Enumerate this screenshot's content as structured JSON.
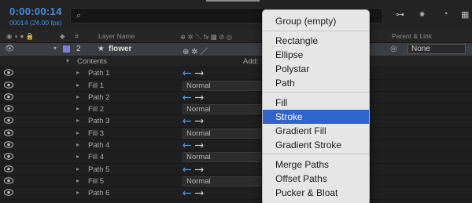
{
  "timecode": "0:00:00:14",
  "frames": "00014 (24.00 fps)",
  "search_icon": "⌕",
  "header": {
    "layer_name": "Layer Name",
    "add": "Add:",
    "parent": "Parent & Link",
    "hash": "#"
  },
  "layer": {
    "number": "2",
    "name": "flower",
    "parent_value": "None",
    "star_icon": "★"
  },
  "contents_label": "Contents",
  "rows": [
    {
      "name": "Path 1",
      "kind": "path"
    },
    {
      "name": "Fill 1",
      "kind": "fill",
      "mode": "Normal"
    },
    {
      "name": "Path 2",
      "kind": "path"
    },
    {
      "name": "Fill 2",
      "kind": "fill",
      "mode": "Normal"
    },
    {
      "name": "Path 3",
      "kind": "path"
    },
    {
      "name": "Fill 3",
      "kind": "fill",
      "mode": "Normal"
    },
    {
      "name": "Path 4",
      "kind": "path"
    },
    {
      "name": "Fill 4",
      "kind": "fill",
      "mode": "Normal"
    },
    {
      "name": "Path 5",
      "kind": "path"
    },
    {
      "name": "Fill 5",
      "kind": "fill",
      "mode": "Normal"
    },
    {
      "name": "Path 6",
      "kind": "path"
    }
  ],
  "menu": {
    "items": [
      "Group (empty)",
      "Rectangle",
      "Ellipse",
      "Polystar",
      "Path",
      "Fill",
      "Stroke",
      "Gradient Fill",
      "Gradient Stroke",
      "Merge Paths",
      "Offset Paths",
      "Pucker & Bloat"
    ],
    "selected": "Stroke"
  },
  "colors": {
    "accent": "#3f8ee8",
    "selection": "#2f64cf",
    "label_swatch": "#7b7fd8"
  }
}
